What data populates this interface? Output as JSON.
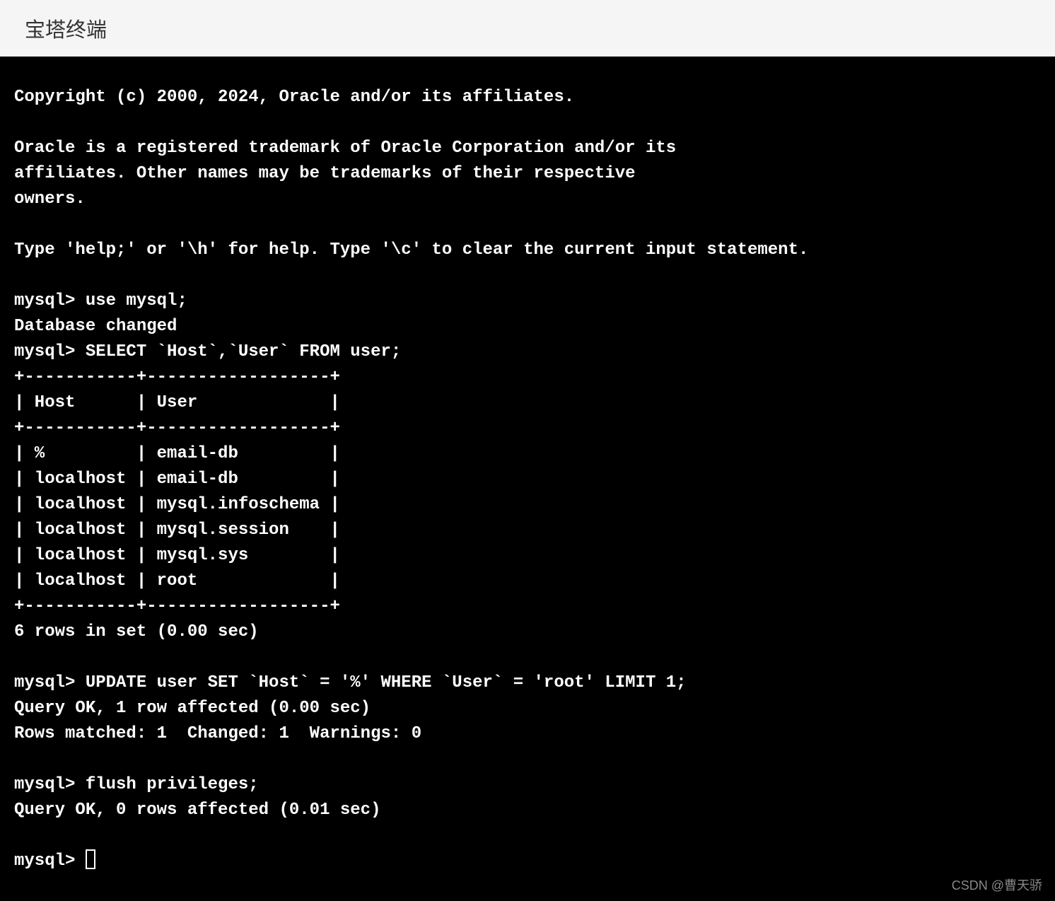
{
  "header": {
    "title": "宝塔终端"
  },
  "terminal": {
    "copyright": "Copyright (c) 2000, 2024, Oracle and/or its affiliates.",
    "trademark1": "Oracle is a registered trademark of Oracle Corporation and/or its",
    "trademark2": "affiliates. Other names may be trademarks of their respective",
    "trademark3": "owners.",
    "help_line": "Type 'help;' or '\\h' for help. Type '\\c' to clear the current input statement.",
    "prompt1": "mysql> use mysql;",
    "response1": "Database changed",
    "prompt2": "mysql> SELECT `Host`,`User` FROM user;",
    "table_border_top": "+-----------+------------------+",
    "table_header": "| Host      | User             |",
    "table_border_mid": "+-----------+------------------+",
    "table_rows": [
      "| %         | email-db         |",
      "| localhost | email-db         |",
      "| localhost | mysql.infoschema |",
      "| localhost | mysql.session    |",
      "| localhost | mysql.sys        |",
      "| localhost | root             |"
    ],
    "table_border_bottom": "+-----------+------------------+",
    "rows_info": "6 rows in set (0.00 sec)",
    "prompt3": "mysql> UPDATE user SET `Host` = '%' WHERE `User` = 'root' LIMIT 1;",
    "response3a": "Query OK, 1 row affected (0.00 sec)",
    "response3b": "Rows matched: 1  Changed: 1  Warnings: 0",
    "prompt4": "mysql> flush privileges;",
    "response4": "Query OK, 0 rows affected (0.01 sec)",
    "prompt5": "mysql> "
  },
  "watermark": "CSDN @曹天骄"
}
